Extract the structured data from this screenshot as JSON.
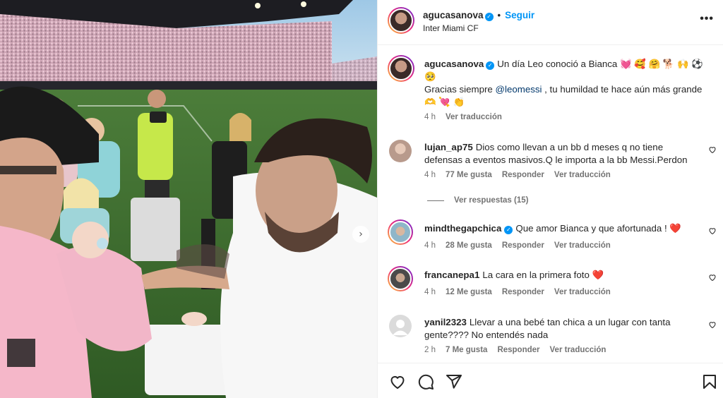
{
  "post": {
    "username": "agucasanova",
    "follow_label": "Seguir",
    "location": "Inter Miami CF",
    "more_icon": "more-icon"
  },
  "caption": {
    "username": "agucasanova",
    "line1": "Un día Leo conoció a Bianca 💓 🥰 🤗 🐕 🙌 ⚽ 🥺",
    "line2_pre": "Gracias siempre ",
    "mention": "@leomessi",
    "line2_post": " , tu humildad te hace aún más grande 🫶 💘 👏",
    "time": "4 h",
    "translate": "Ver traducción"
  },
  "comments": [
    {
      "username": "lujan_ap75",
      "text": "Dios como llevan a un bb d meses q no tiene defensas a eventos masivos.Q le importa a la bb Messi.Perdon",
      "time": "4 h",
      "likes": "77 Me gusta",
      "reply": "Responder",
      "translate": "Ver traducción"
    },
    {
      "username": "mindthegapchica",
      "text": "Que amor Bianca y que afortunada ! ❤️",
      "time": "4 h",
      "likes": "28 Me gusta",
      "reply": "Responder",
      "translate": "Ver traducción"
    },
    {
      "username": "francanepa1",
      "text": "La cara en la primera foto ❤️",
      "time": "4 h",
      "likes": "12 Me gusta",
      "reply": "Responder",
      "translate": "Ver traducción"
    },
    {
      "username": "yanil2323",
      "text": "Llevar a una bebé tan chica a un lugar con tanta gente???? No entendés nada",
      "time": "2 h",
      "likes": "7 Me gusta",
      "reply": "Responder",
      "translate": "Ver traducción"
    }
  ],
  "view_replies": "Ver respuestas (15)",
  "actions": {
    "like_icon": "heart-icon",
    "comment_icon": "comment-icon",
    "share_icon": "share-icon",
    "save_icon": "bookmark-icon"
  },
  "colors": {
    "link_blue": "#0095f6",
    "mention": "#00376b",
    "secondary_text": "#737373",
    "like_red": "#ed4956",
    "pink_shirt": "#f5b7c9"
  }
}
